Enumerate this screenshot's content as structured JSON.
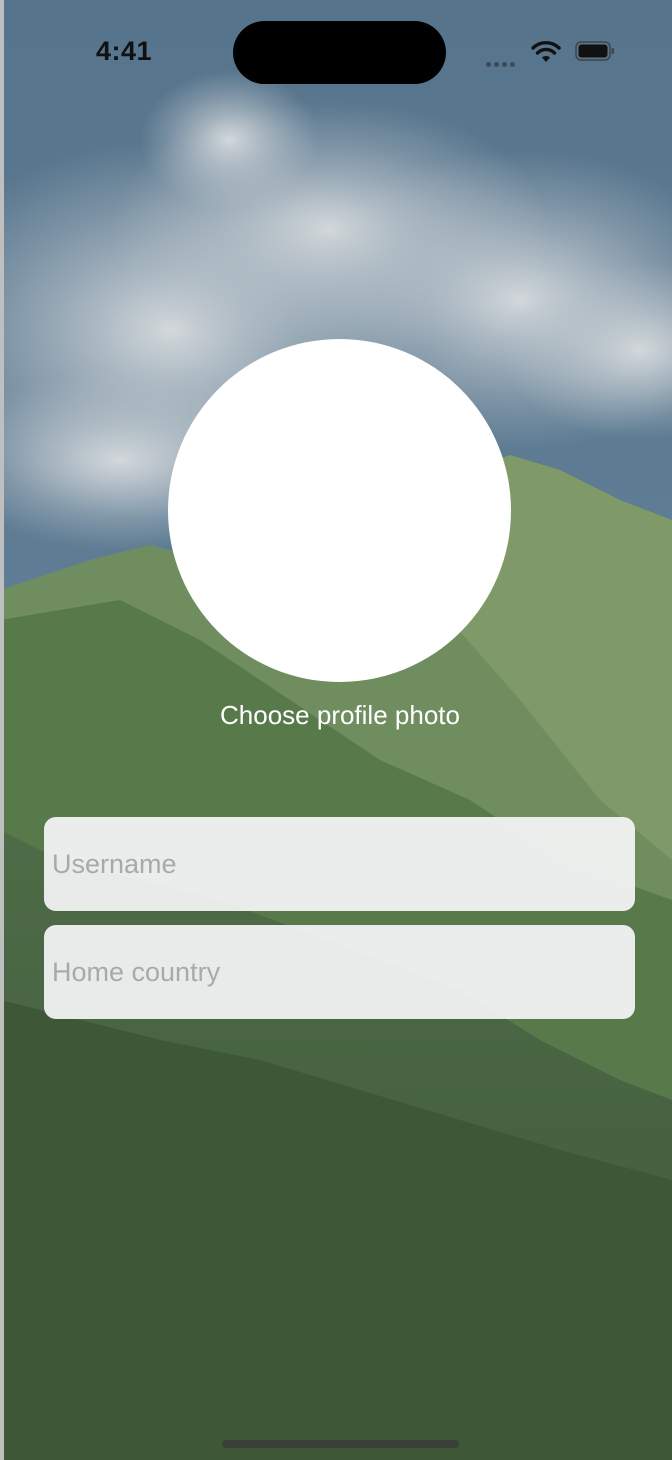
{
  "status_bar": {
    "time": "4:41",
    "icons": [
      "cellular-signal-icon",
      "wifi-icon",
      "battery-icon"
    ]
  },
  "background": {
    "description_icon": "mountain-landscape-image",
    "colors": {
      "sky": "#5d7a8f",
      "cloud": "#c9cfd3",
      "mountain": "#6a8a58",
      "forest": "#3f5c3a"
    }
  },
  "profile": {
    "photo_label": "Choose profile photo"
  },
  "form": {
    "username_placeholder": "Username",
    "username_value": "",
    "country_placeholder": "Home country",
    "country_value": ""
  }
}
